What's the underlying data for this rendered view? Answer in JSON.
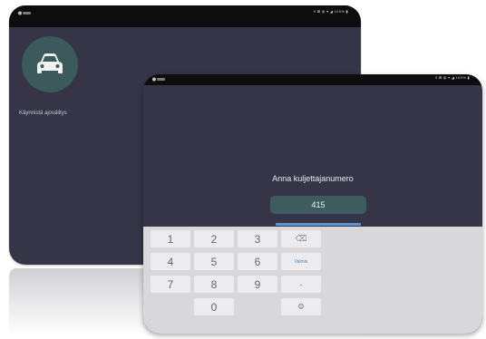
{
  "back_screen": {
    "status_right": "9 ⊠ ◍ ▾ ◢ 100% ▮",
    "car_label": "Käynnistä ajovälitys"
  },
  "front_screen": {
    "status_right": "9 ⊠ ◍ ▾ ◢ 100% ▮",
    "prompt": "Anna kuljettajanumero",
    "input_value": "415"
  },
  "keypad": {
    "keys": [
      "1",
      "2",
      "3",
      "4",
      "5",
      "6",
      "7",
      "8",
      "9",
      "0"
    ],
    "backspace_icon": "⌫",
    "done_label": "Valmis",
    "dash_label": "-",
    "settings_icon": "⚙"
  },
  "colors": {
    "tablet_background": "#363447",
    "car_button": "#3c5a5c",
    "accent": "#3f85c8"
  }
}
